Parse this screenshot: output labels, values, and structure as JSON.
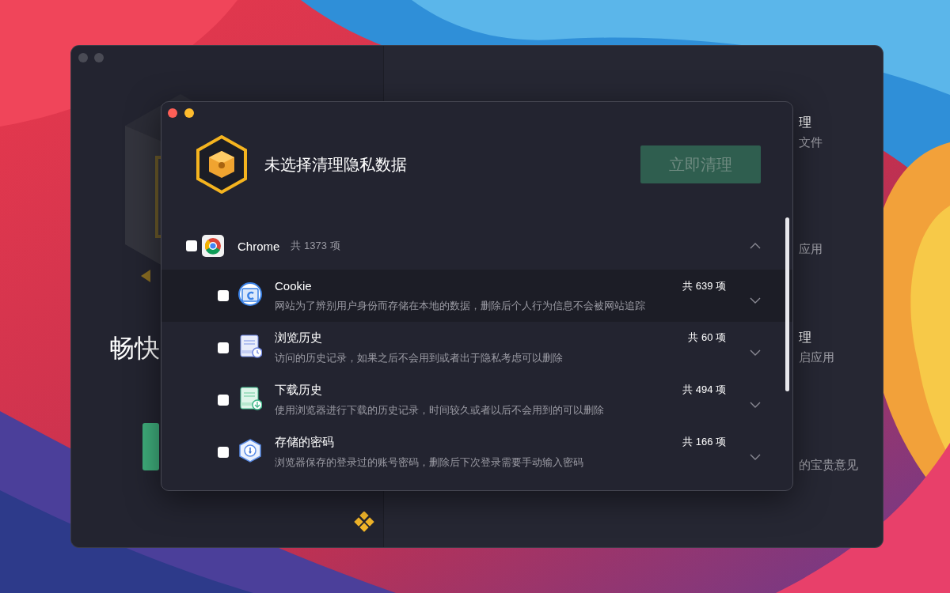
{
  "background_window": {
    "heading": "畅快",
    "items": [
      {
        "title": "理",
        "subtitle": "文件"
      },
      {
        "subtitle": "应用"
      },
      {
        "title": "理",
        "subtitle": "启应用"
      },
      {
        "subtitle": "的宝贵意见"
      }
    ]
  },
  "dialog": {
    "title": "未选择清理隐私数据",
    "clean_button": {
      "label": "立即清理",
      "disabled": true
    },
    "browser": {
      "name": "Chrome",
      "count": "共 1373 项",
      "checked": false,
      "expanded": true,
      "items": [
        {
          "kind": "cookie",
          "title": "Cookie",
          "description": "网站为了辨别用户身份而存储在本地的数据，删除后个人行为信息不会被网站追踪",
          "count": "共 639 项",
          "checked": false,
          "selected": true,
          "expanded": false
        },
        {
          "kind": "history",
          "title": "浏览历史",
          "description": "访问的历史记录，如果之后不会用到或者出于隐私考虑可以删除",
          "count": "共 60 项",
          "checked": false,
          "selected": false,
          "expanded": false
        },
        {
          "kind": "download",
          "title": "下载历史",
          "description": "使用浏览器进行下载的历史记录，时间较久或者以后不会用到的可以删除",
          "count": "共 494 项",
          "checked": false,
          "selected": false,
          "expanded": false
        },
        {
          "kind": "password",
          "title": "存储的密码",
          "description": "浏览器保存的登录过的账号密码，删除后下次登录需要手动输入密码",
          "count": "共 166 项",
          "checked": false,
          "selected": false,
          "expanded": false
        }
      ]
    }
  }
}
